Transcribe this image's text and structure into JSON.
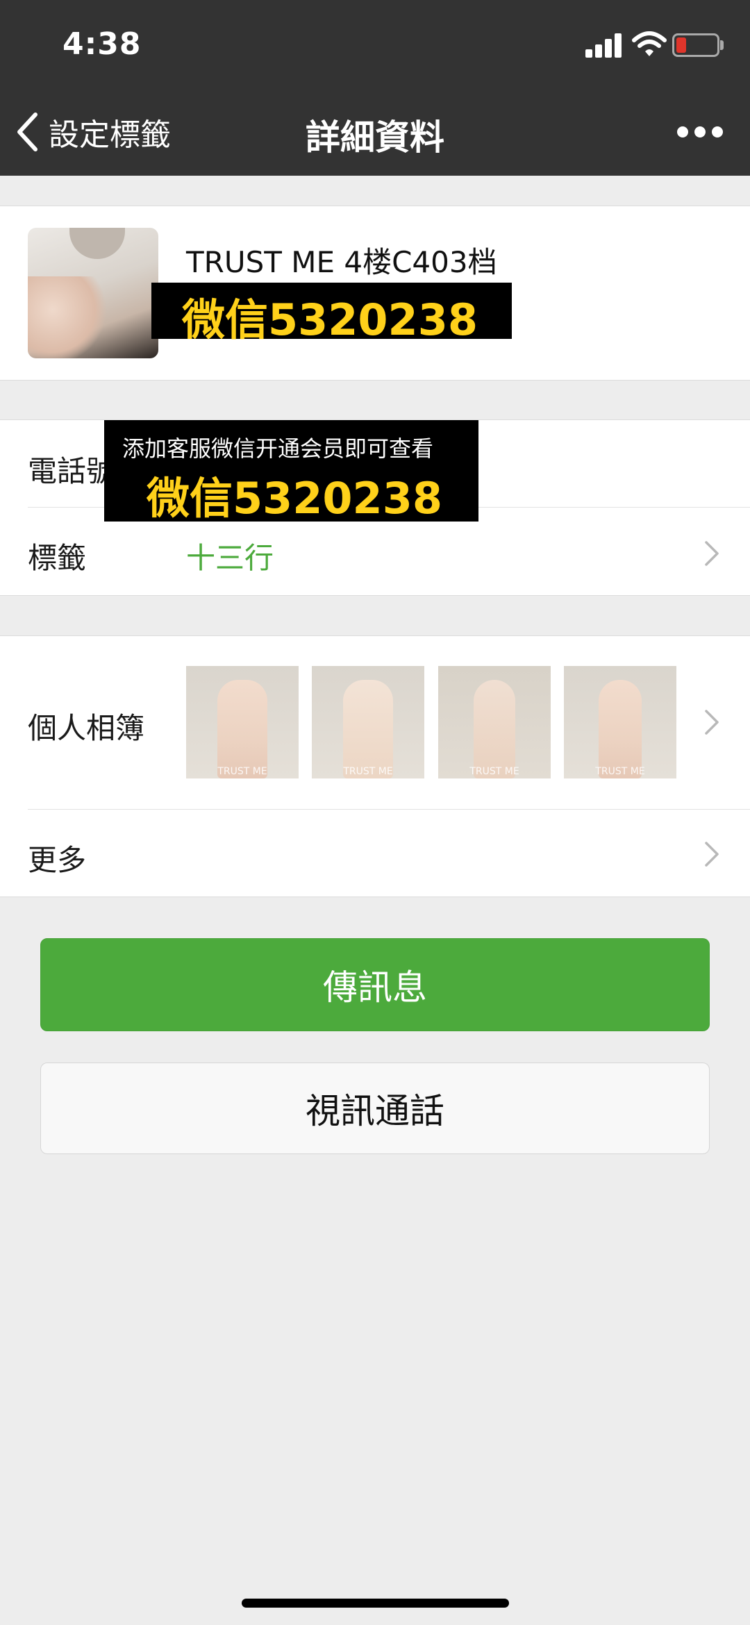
{
  "status_bar": {
    "time": "4:38"
  },
  "nav": {
    "back_label": "設定標籤",
    "title": "詳細資料"
  },
  "profile": {
    "name": "TRUST ME 4楼C403档",
    "id_tail": "6",
    "promo": "微信5320238"
  },
  "info_rows": {
    "phone_label": "電話號",
    "tag_label": "標籤",
    "tag_value": "十三行",
    "promo_line1": "添加客服微信开通会员即可查看",
    "promo_line2": "微信5320238"
  },
  "album": {
    "label": "個人相簿",
    "thumbnails": [
      {
        "watermark": "TRUST ME"
      },
      {
        "watermark": "TRUST ME"
      },
      {
        "watermark": "TRUST ME"
      },
      {
        "watermark": "TRUST ME"
      }
    ]
  },
  "more_row": {
    "label": "更多"
  },
  "buttons": {
    "message": "傳訊息",
    "video_call": "視訊通話"
  },
  "colors": {
    "header_bg": "#333333",
    "accent_green": "#4caa3c",
    "promo_yellow": "#ffd11a",
    "battery_red": "#e0352b",
    "page_bg": "#ededed"
  }
}
